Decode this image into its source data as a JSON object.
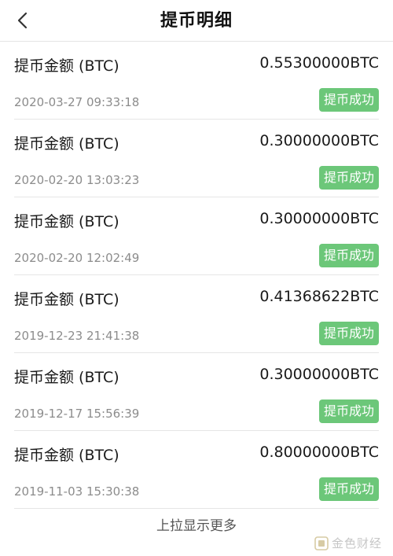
{
  "header": {
    "title": "提币明细"
  },
  "records": [
    {
      "label": "提币金额 (BTC)",
      "amount": "0.55300000BTC",
      "time": "2020-03-27 09:33:18",
      "status": "提币成功"
    },
    {
      "label": "提币金额 (BTC)",
      "amount": "0.30000000BTC",
      "time": "2020-02-20 13:03:23",
      "status": "提币成功"
    },
    {
      "label": "提币金额 (BTC)",
      "amount": "0.30000000BTC",
      "time": "2020-02-20 12:02:49",
      "status": "提币成功"
    },
    {
      "label": "提币金额 (BTC)",
      "amount": "0.41368622BTC",
      "time": "2019-12-23 21:41:38",
      "status": "提币成功"
    },
    {
      "label": "提币金额 (BTC)",
      "amount": "0.30000000BTC",
      "time": "2019-12-17 15:56:39",
      "status": "提币成功"
    },
    {
      "label": "提币金额 (BTC)",
      "amount": "0.80000000BTC",
      "time": "2019-11-03 15:30:38",
      "status": "提币成功"
    }
  ],
  "footer": {
    "load_more": "上拉显示更多"
  },
  "watermark": {
    "text": "金色财经"
  },
  "colors": {
    "status_badge": "#6cc779",
    "timestamp": "#8c8c8c"
  },
  "icons": {
    "back": "chevron-left-icon",
    "watermark_logo": "logo-icon"
  }
}
